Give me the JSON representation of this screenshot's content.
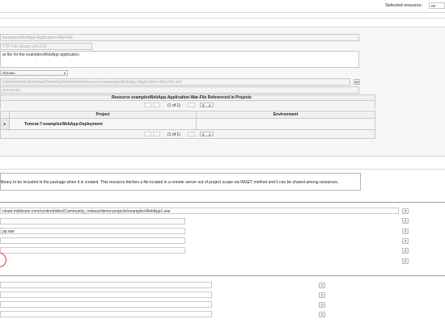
{
  "top_bar": {
    "selected_resource_label": "Selected resource:",
    "selected_resource_value": "ex"
  },
  "resource_form": {
    "name_value": "examplesWebApp-Application-War-File",
    "type_value": "TTP File Library (v4.2.0)",
    "description_value": "ar file for the examplesWebApp application",
    "unknown_select": "nknown",
    "path_value": "/Users/mohandberhoun/Downloads/midvision/resources/examplesWebApp-Application-War-File.xml",
    "path_button": "M",
    "resources_field": "resources"
  },
  "referenced_table": {
    "title": "Resource examplesWebApp-Application-War-File Referenced in Projects",
    "pager_top": "(1 of 1)",
    "page_size": "5",
    "columns": [
      "Project",
      "Environment"
    ],
    "rows": [
      {
        "project": "Tomcat-7-examplesWebApp-Deployment",
        "environment": ""
      }
    ],
    "pager_bottom": "(1 of 1)"
  },
  "info_box": {
    "text": "library to be included in the package when it is created. This resource fetches a file located in a remote server out of project scope via WGET method and it can be shared among resources."
  },
  "params_section": {
    "url_value": "nload.midvision.com/content/sites/Community_release/demo-projects/examplesWebApp1.war",
    "file_value": "pp.war",
    "help_label": "?"
  },
  "colors": {
    "accent_circle": "#e23b3b",
    "border": "#c9c9c9"
  }
}
